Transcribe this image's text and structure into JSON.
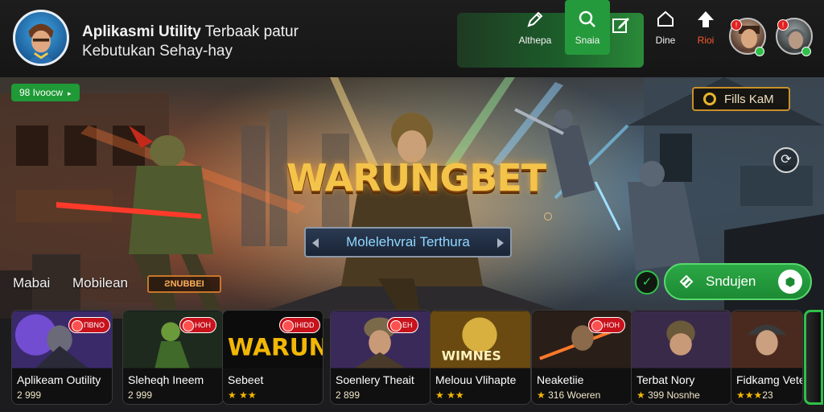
{
  "header": {
    "title_bold": "Aplikasmi Utility",
    "title_rest": " Terbaak patur",
    "subtitle": "Kebutukan Sehay-hay",
    "tools": [
      {
        "label": "Althepa",
        "icon": "pen-icon"
      },
      {
        "label": "Snaia",
        "icon": "search-icon"
      },
      {
        "label": "",
        "icon": "edit-icon"
      },
      {
        "label": "Dine",
        "icon": "home-icon"
      },
      {
        "label": "Rioi",
        "icon": "arrow-up-icon"
      }
    ],
    "avatars": [
      {
        "badge": "!",
        "icon": "avatar"
      },
      {
        "badge": "!",
        "icon": "avatar"
      }
    ]
  },
  "hero": {
    "tag": "98 Ivoocw",
    "tag_arrow": "▸",
    "pill_label": "Fills KaM",
    "round_icon": "⟳",
    "brand_title": "WARUNGBET",
    "brand_subtitle": "Molelehvrai Terthura",
    "categories": [
      "Mabai",
      "Mobilean"
    ],
    "category_badge": "ƧNUBBEI",
    "circle_icon": "✓",
    "cta_label": "Sndujen",
    "cta_badge_icon": "⬢"
  },
  "cards": [
    {
      "name": "Aplikeam Outility",
      "meta": "2 999",
      "badge": "ΠBNO",
      "stars": ""
    },
    {
      "name": "Sleheqh Ineem",
      "meta": "2 999",
      "badge": "HOH",
      "stars": ""
    },
    {
      "name": "Sebeet",
      "meta": "",
      "badge": "IHIDD",
      "stars": "★ ★★"
    },
    {
      "name": "Soenlery Theait",
      "meta": "2 899",
      "badge": "EH",
      "stars": ""
    },
    {
      "name": "Melouu Vlihapte",
      "meta": "",
      "badge": "",
      "stars": "★ ★★"
    },
    {
      "name": "Neaketiie",
      "meta": "316 Woeren",
      "badge": "HOH",
      "stars": "★"
    },
    {
      "name": "Terbat Nory",
      "meta": "399 Nosnhe",
      "badge": "",
      "stars": "★"
    },
    {
      "name": "Fidkamg Vete",
      "meta": "23",
      "badge": "",
      "stars": "★★★"
    }
  ],
  "card_art_text": [
    "WARUNK",
    "WIMNES"
  ],
  "colors": {
    "accent_green": "#2fbf4a",
    "brand_gold": "#f4c44a",
    "badge_red": "#c8121c",
    "header_bg": "#1a1a1a"
  }
}
